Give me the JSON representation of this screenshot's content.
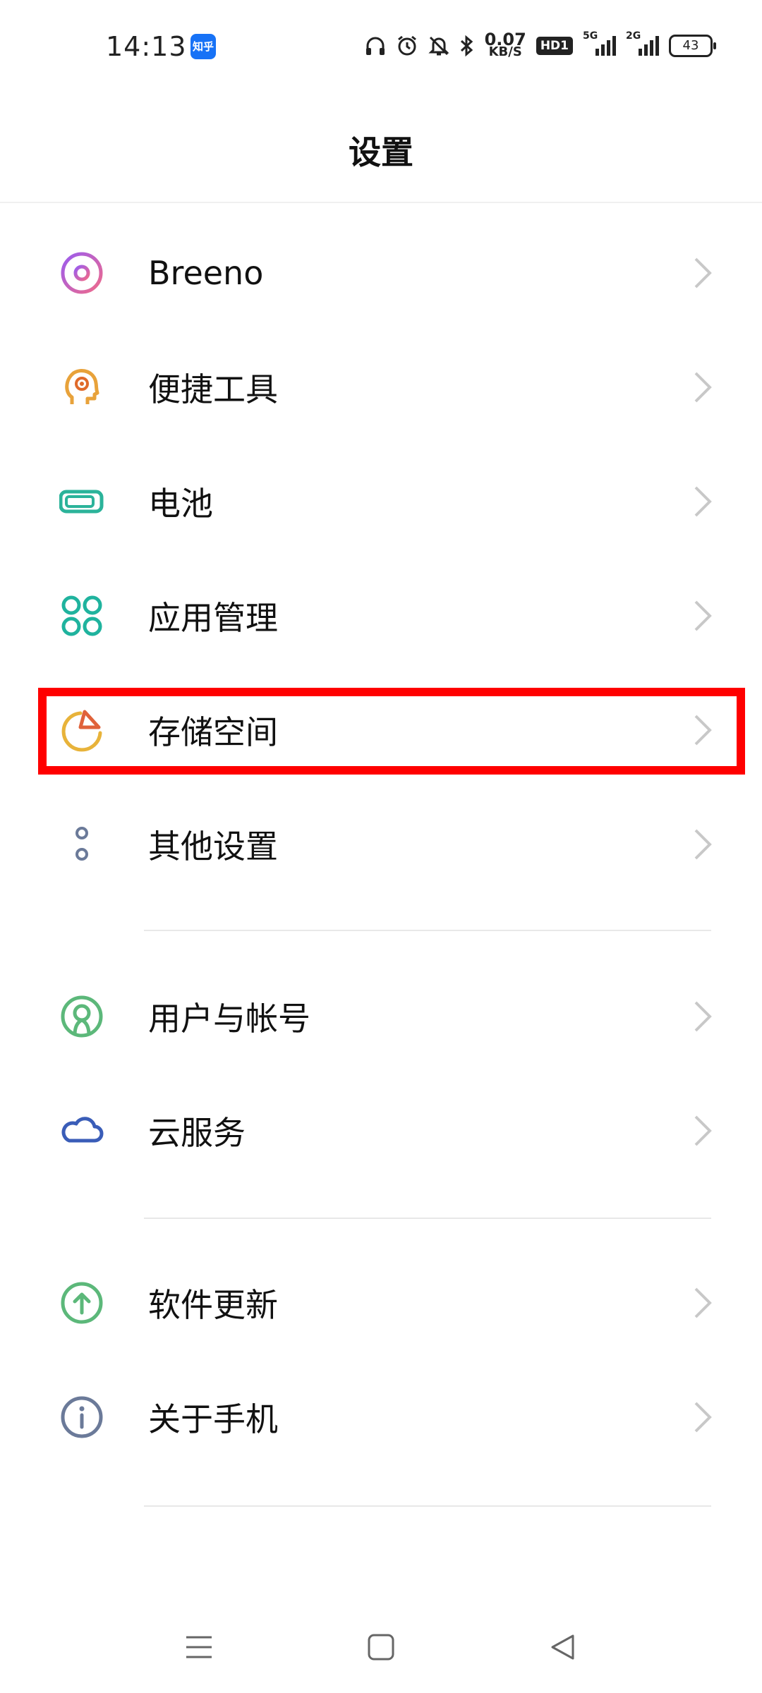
{
  "status_bar": {
    "time": "14:13",
    "app_badge": "知乎",
    "net_speed_value": "0.07",
    "net_speed_unit": "KB/S",
    "hd_badge": "HD1",
    "signal1_label": "5G",
    "signal2_label": "2G",
    "battery": "43",
    "icons": [
      "headphones-icon",
      "alarm-icon",
      "mute-bell-icon",
      "bluetooth-icon"
    ]
  },
  "header": {
    "title": "设置"
  },
  "settings": {
    "items": [
      {
        "label": "Breeno",
        "icon": "breeno-icon",
        "color": "#c062d8"
      },
      {
        "label": "便捷工具",
        "icon": "shortcut-tools-icon",
        "color": "#e8a23a"
      },
      {
        "label": "电池",
        "icon": "battery-icon",
        "color": "#2bb39a"
      },
      {
        "label": "应用管理",
        "icon": "apps-icon",
        "color": "#1fb39e"
      },
      {
        "label": "存储空间",
        "icon": "storage-pie-icon",
        "color": "#e8b33a"
      },
      {
        "label": "其他设置",
        "icon": "more-settings-icon",
        "color": "#6b7a99"
      },
      {
        "label": "用户与帐号",
        "icon": "user-account-icon",
        "color": "#5cb87a"
      },
      {
        "label": "云服务",
        "icon": "cloud-icon",
        "color": "#3a5db8"
      },
      {
        "label": "软件更新",
        "icon": "software-update-icon",
        "color": "#5cb87a"
      },
      {
        "label": "关于手机",
        "icon": "about-phone-icon",
        "color": "#6b7a99"
      }
    ],
    "highlighted": "存储空间"
  },
  "navbar": {
    "buttons": [
      "menu-icon",
      "home-icon",
      "back-icon"
    ]
  }
}
